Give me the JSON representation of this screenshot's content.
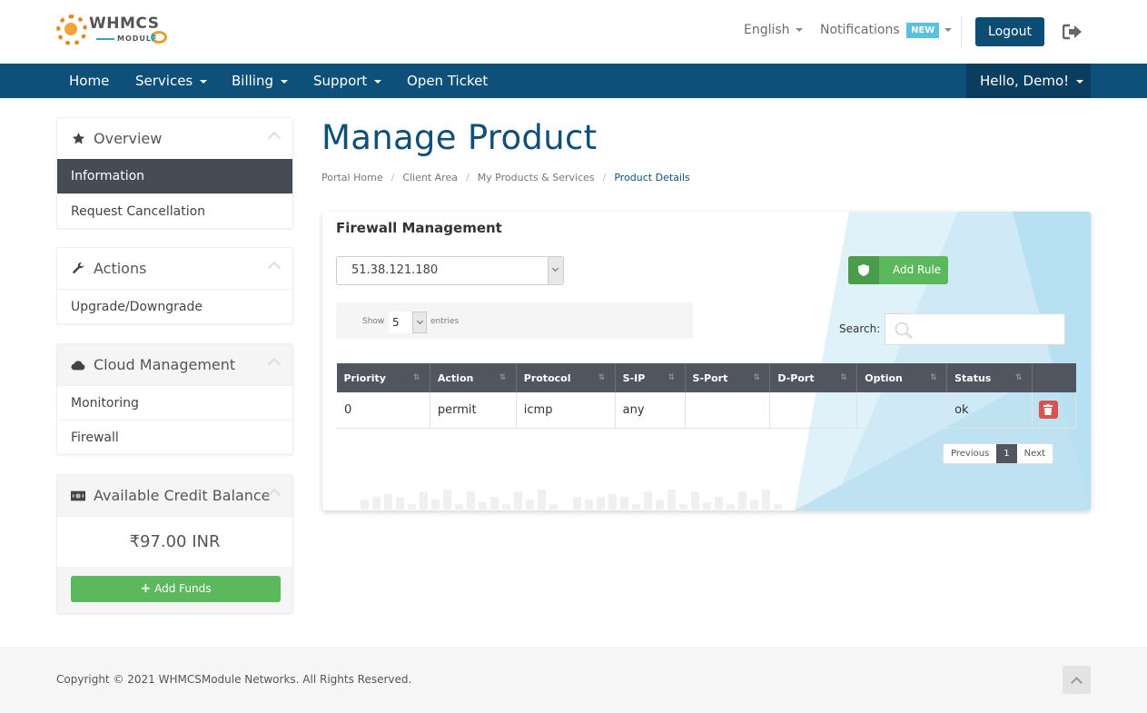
{
  "header": {
    "logo_text_main": "WHMCS",
    "logo_text_sub": "MODULE",
    "language": "English",
    "notifications": "Notifications",
    "notifications_badge": "NEW",
    "logout_label": "Logout",
    "exit_icon": "sign-out-icon"
  },
  "nav": {
    "items": [
      {
        "label": "Home",
        "dropdown": false
      },
      {
        "label": "Services",
        "dropdown": true
      },
      {
        "label": "Billing",
        "dropdown": true
      },
      {
        "label": "Support",
        "dropdown": true
      },
      {
        "label": "Open Ticket",
        "dropdown": false
      }
    ],
    "user_menu": "Hello, Demo!"
  },
  "sidebar": {
    "panels": [
      {
        "title": "Overview",
        "icon": "star-icon",
        "items": [
          "Information",
          "Request Cancellation"
        ],
        "active": "Information"
      },
      {
        "title": "Actions",
        "icon": "wrench-icon",
        "items": [
          "Upgrade/Downgrade"
        ]
      },
      {
        "title": "Cloud Management",
        "icon": "cloud-icon",
        "items": [
          "Monitoring",
          "Firewall"
        ]
      },
      {
        "title": "Available Credit Balance",
        "icon": "money-icon",
        "balance": "₹97.00 INR",
        "button": "Add Funds"
      }
    ]
  },
  "main": {
    "title": "Manage Product",
    "breadcrumb": [
      "Portal Home",
      "Client Area",
      "My Products & Services",
      "Product Details"
    ],
    "firewall": {
      "title": "Firewall Management",
      "ip_selected": "51.38.121.180",
      "add_rule_label": "Add Rule",
      "length": {
        "show": "Show",
        "value": "5",
        "entries": "entries"
      },
      "search_label": "Search:",
      "search_value": "",
      "columns": [
        "Priority",
        "Action",
        "Protocol",
        "S-IP",
        "S-Port",
        "D-Port",
        "Option",
        "Status",
        ""
      ],
      "rows": [
        {
          "priority": "0",
          "action": "permit",
          "protocol": "icmp",
          "s_ip": "any",
          "s_port": "",
          "d_port": "",
          "option": "",
          "status": "ok"
        }
      ],
      "pagination": {
        "previous": "Previous",
        "current": "1",
        "next": "Next"
      }
    }
  },
  "footer": {
    "copyright": "Copyright © 2021 WHMCSModule Networks. All Rights Reserved."
  },
  "colors": {
    "brand_blue": "#0e5079",
    "success_green": "#5cb85c",
    "danger_red": "#d9534f",
    "table_header": "#505560",
    "badge_info": "#5bc0de"
  }
}
